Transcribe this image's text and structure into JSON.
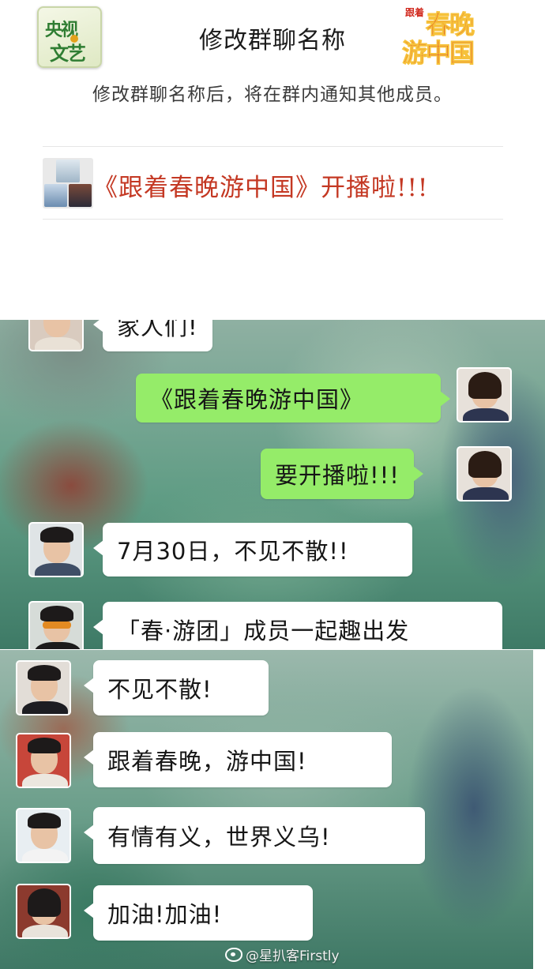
{
  "header": {
    "left_logo": "央视文艺",
    "left_logo_line1": "央视",
    "left_logo_line2": "文艺",
    "right_logo": "跟着春晚游中国",
    "right_logo_tag": "跟着",
    "right_logo_line1": "春晚",
    "right_logo_line2": "游中国",
    "title": "修改群聊名称"
  },
  "notice": "修改群聊名称后，将在群内通知其他成员。",
  "group": {
    "name": "《跟着春晚游中国》开播啦!!!"
  },
  "chat_top": [
    {
      "side": "left",
      "text": "家人们!"
    },
    {
      "side": "right",
      "text": "《跟着春晚游中国》"
    },
    {
      "side": "right",
      "text": "要开播啦!!!"
    },
    {
      "side": "left",
      "text": "7月30日，不见不散!!"
    },
    {
      "side": "left",
      "text": "「春·游团」成员一起趣出发"
    }
  ],
  "chat_bottom": [
    {
      "side": "left",
      "text": "不见不散!"
    },
    {
      "side": "left",
      "text": "跟着春晚，游中国!"
    },
    {
      "side": "left",
      "text": "有情有义，世界义乌!"
    },
    {
      "side": "left",
      "text": "加油!加油!"
    }
  ],
  "watermark": "@星扒客Firstly",
  "colors": {
    "accent_red": "#c43823",
    "wechat_green": "#95ec69",
    "bubble_white": "#ffffff"
  },
  "icons": [
    "weibo-icon"
  ]
}
